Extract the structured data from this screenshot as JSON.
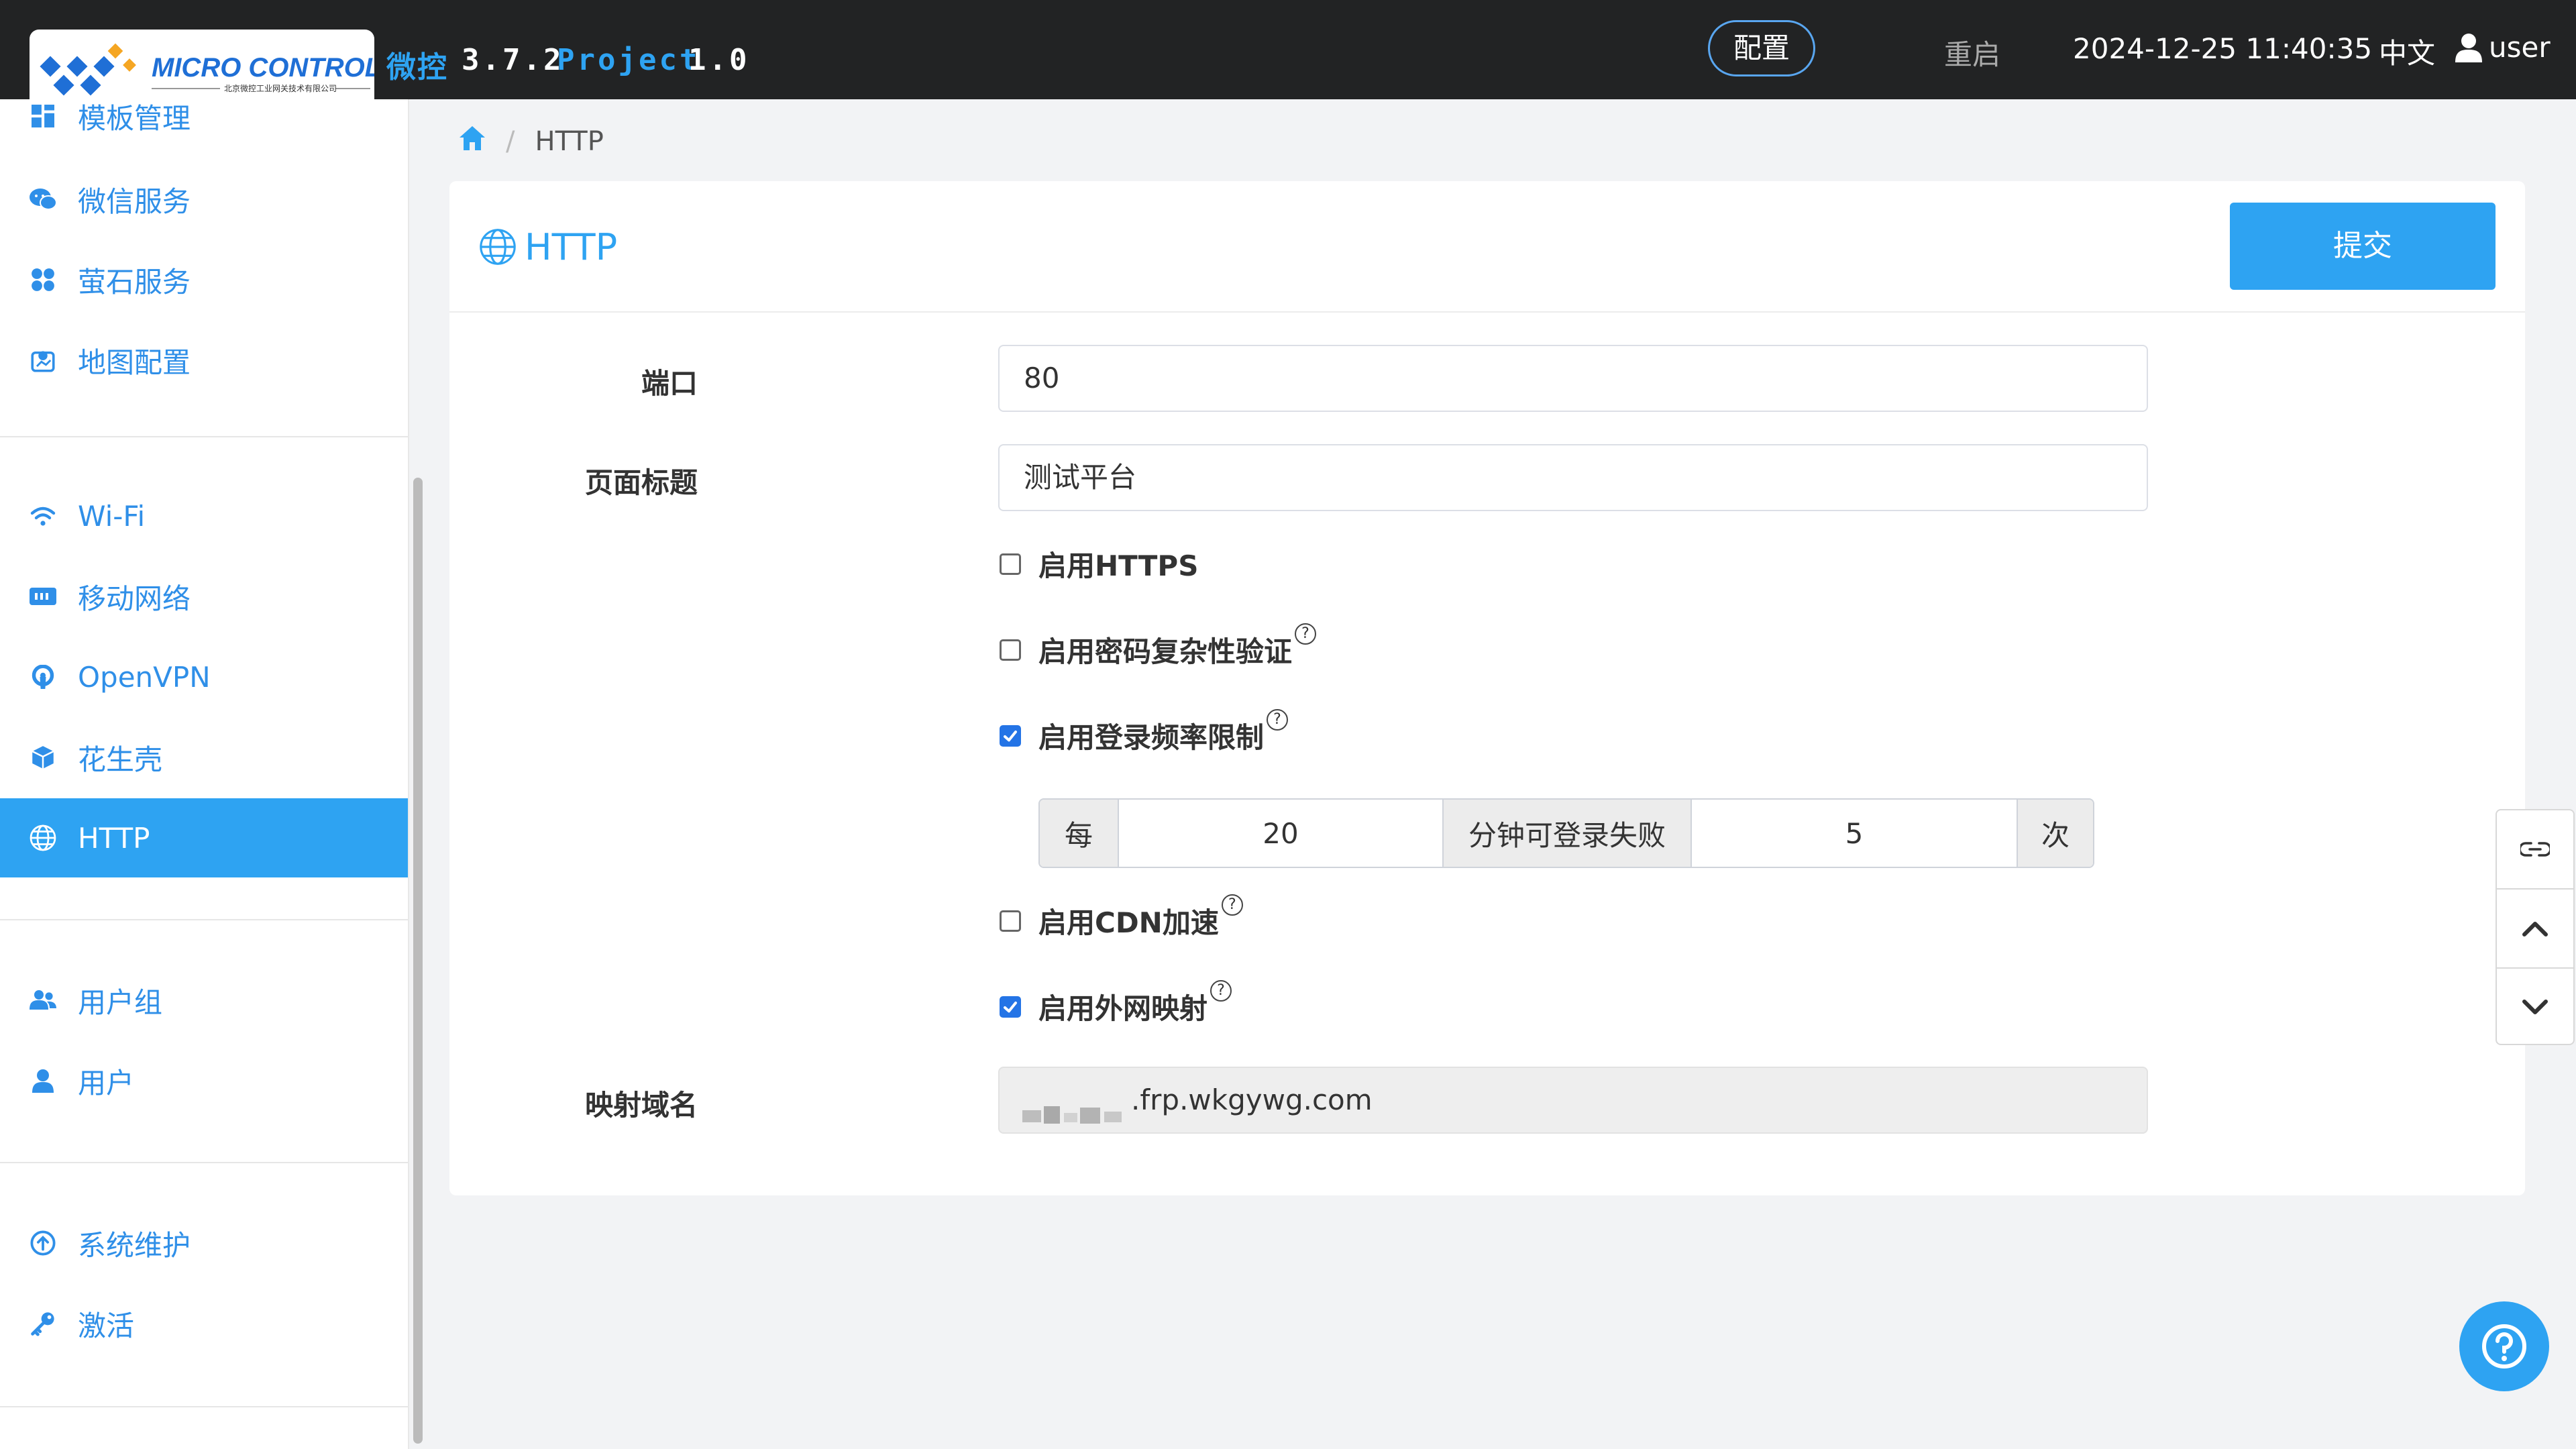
{
  "header": {
    "logo_text": "MICRO CONTROL",
    "logo_subtext": "北京微控工业网关技术有限公司",
    "product_name": "微控",
    "product_version": "3.7.2",
    "project_label": "Project",
    "project_version": "1.0",
    "config_label": "配置",
    "restart_label": "重启",
    "datetime": "2024-12-25 11:40:35",
    "language": "中文",
    "username": "user"
  },
  "sidebar": {
    "items": [
      {
        "label": "模板管理",
        "icon": "grid-icon"
      },
      {
        "label": "微信服务",
        "icon": "wechat-icon"
      },
      {
        "label": "萤石服务",
        "icon": "ezviz-icon"
      },
      {
        "label": "地图配置",
        "icon": "map-icon"
      },
      {
        "label": "Wi-Fi",
        "icon": "wifi-icon"
      },
      {
        "label": "移动网络",
        "icon": "sim-card-icon"
      },
      {
        "label": "OpenVPN",
        "icon": "openvpn-icon"
      },
      {
        "label": "花生壳",
        "icon": "cube-icon"
      },
      {
        "label": "HTTP",
        "icon": "globe-icon",
        "active": true
      },
      {
        "label": "用户组",
        "icon": "users-icon"
      },
      {
        "label": "用户",
        "icon": "user-icon"
      },
      {
        "label": "系统维护",
        "icon": "upload-circle-icon"
      },
      {
        "label": "激活",
        "icon": "key-icon"
      }
    ]
  },
  "breadcrumb": {
    "current": "HTTP"
  },
  "page": {
    "title": "HTTP",
    "submit_label": "提交"
  },
  "form": {
    "port_label": "端口",
    "port_value": "80",
    "page_title_label": "页面标题",
    "page_title_value": "测试平台",
    "https_label": "启用HTTPS",
    "https_checked": false,
    "password_complexity_label": "启用密码复杂性验证",
    "password_complexity_checked": false,
    "login_rate_label": "启用登录频率限制",
    "login_rate_checked": true,
    "rate_prefix": "每",
    "rate_minutes": "20",
    "rate_middle": "分钟可登录失败",
    "rate_times": "5",
    "rate_suffix": "次",
    "cdn_label": "启用CDN加速",
    "cdn_checked": false,
    "external_mapping_label": "启用外网映射",
    "external_mapping_checked": true,
    "mapping_domain_label": "映射域名",
    "mapping_domain_value": ".frp.wkgywg.com",
    "help_glyph": "?"
  },
  "colors": {
    "accent": "#2ea3f2",
    "topbar": "#222324",
    "checkbox_checked": "#2474e6"
  }
}
